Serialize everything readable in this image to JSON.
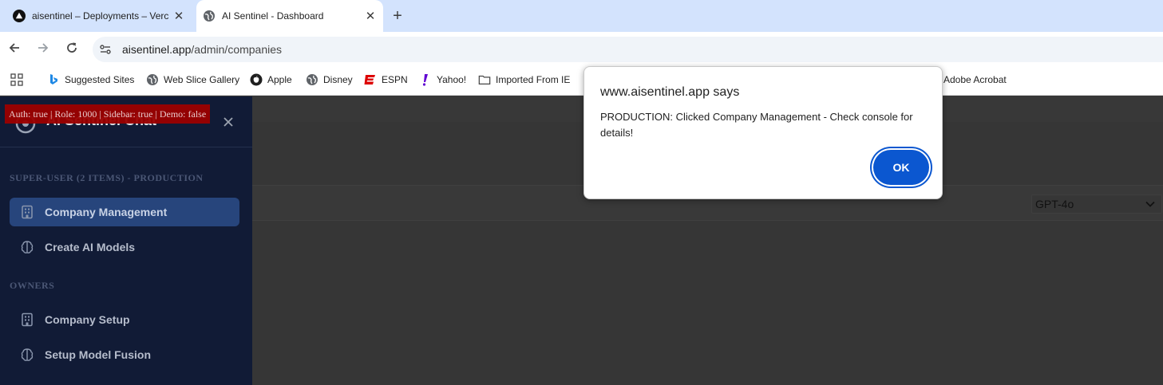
{
  "browser": {
    "tabs": [
      {
        "title": "aisentinel – Deployments – Verc",
        "active": false,
        "favicon": "vercel-triangle-icon"
      },
      {
        "title": "AI Sentinel - Dashboard",
        "active": true,
        "favicon": "globe-icon"
      }
    ],
    "close_glyph": "✕",
    "new_tab_glyph": "+",
    "url_host": "aisentinel.app",
    "url_path": "/admin/companies"
  },
  "bookmarks": [
    {
      "label": "Suggested Sites",
      "icon": "bing-icon"
    },
    {
      "label": "Web Slice Gallery",
      "icon": "globe-icon"
    },
    {
      "label": "Apple",
      "icon": "apple-icon"
    },
    {
      "label": "Disney",
      "icon": "globe-icon"
    },
    {
      "label": "ESPN",
      "icon": "espn-icon"
    },
    {
      "label": "Yahoo!",
      "icon": "yahoo-icon"
    },
    {
      "label": "Imported From IE",
      "icon": "folder-icon"
    },
    {
      "label": "Adobe Acrobat",
      "icon": ""
    }
  ],
  "app": {
    "brand": "AI Sentinel Chat",
    "debug_banner": "Auth: true | Role: 1000 | Sidebar: true | Demo: false",
    "sections": [
      {
        "label": "SUPER-USER (2 ITEMS) - PRODUCTION",
        "items": [
          {
            "label": "Company Management",
            "icon": "building-icon",
            "active": true
          },
          {
            "label": "Create AI Models",
            "icon": "brain-icon",
            "active": false
          }
        ]
      },
      {
        "label": "OWNERS",
        "items": [
          {
            "label": "Company Setup",
            "icon": "building-icon",
            "active": false
          },
          {
            "label": "Setup Model Fusion",
            "icon": "brain-icon",
            "active": false
          }
        ]
      }
    ],
    "model_select": {
      "value": "GPT-4o"
    }
  },
  "dialog": {
    "title": "www.aisentinel.app says",
    "message": "PRODUCTION: Clicked Company Management - Check console for details!",
    "ok_label": "OK"
  },
  "colors": {
    "sidebar_bg": "#111b36",
    "active_item_bg": "#27457c",
    "debug_bg": "#9c0000",
    "dialog_button": "#0b57d0",
    "tabstrip_bg": "#d3e3fd"
  }
}
